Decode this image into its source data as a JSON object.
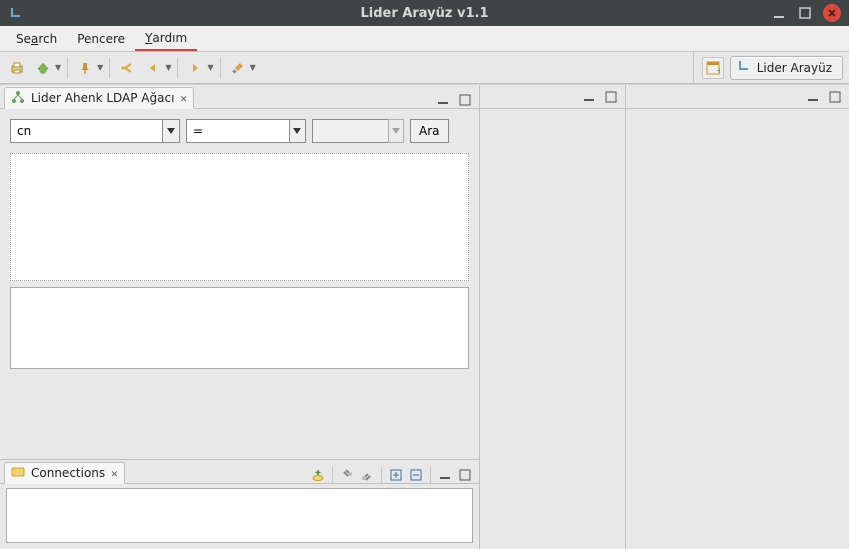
{
  "window": {
    "title": "Lider Arayüz v1.1"
  },
  "menu": {
    "search_pre": "Se",
    "search_ul": "a",
    "search_post": "rch",
    "pencere": "Pencere",
    "yardim_ul": "Y",
    "yardim_post": "ardım"
  },
  "perspective": {
    "label": "Lider Arayüz"
  },
  "ldap_view": {
    "tab_label": "Lider Ahenk LDAP Ağacı",
    "search": {
      "attr_value": "cn",
      "op_value": "=",
      "val_value": "",
      "button": "Ara"
    }
  },
  "connections_view": {
    "tab_label": "Connections"
  }
}
